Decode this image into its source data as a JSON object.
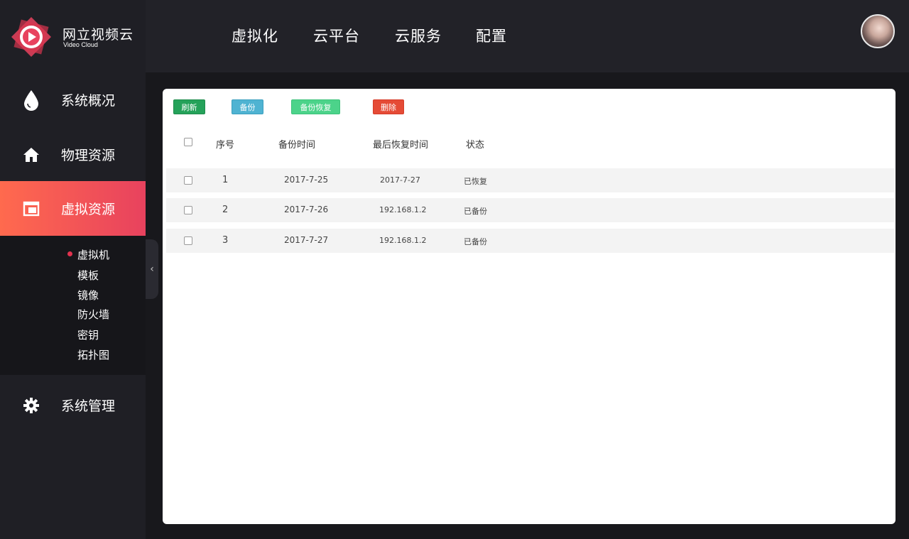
{
  "brand": {
    "name": "网立视频云",
    "subtitle": "Video Cloud",
    "accent": "#e8425e"
  },
  "sidebar": {
    "items": [
      {
        "label": "系统概况",
        "icon": "drop-icon"
      },
      {
        "label": "物理资源",
        "icon": "home-icon"
      },
      {
        "label": "虚拟资源",
        "icon": "window-icon",
        "active": true
      },
      {
        "label": "系统管理",
        "icon": "gear-icon"
      }
    ],
    "submenu": [
      "虚拟机",
      "模板",
      "镜像",
      "防火墙",
      "密钥",
      "拓扑图"
    ],
    "submenu_selected": "虚拟机"
  },
  "topnav": {
    "tabs": [
      "虚拟化",
      "云平台",
      "云服务",
      "配置"
    ]
  },
  "toolbar": {
    "refresh": "刷新",
    "backup": "备份",
    "restore": "备份恢复",
    "delete": "删除"
  },
  "table": {
    "headers": [
      "序号",
      "备份时间",
      "最后恢复时间",
      "状态"
    ],
    "rows": [
      {
        "index": "1",
        "backup_time": "2017-7-25",
        "last_restore": "2017-7-27",
        "status": "已恢复"
      },
      {
        "index": "2",
        "backup_time": "2017-7-26",
        "last_restore": "192.168.1.2",
        "status": "已备份"
      },
      {
        "index": "3",
        "backup_time": "2017-7-27",
        "last_restore": "192.168.1.2",
        "status": "已备份"
      }
    ]
  },
  "colors": {
    "refresh": "#25a25a",
    "backup": "#4fb3d2",
    "restore": "#4cd38a",
    "delete": "#e54b36",
    "active_gradient_start": "#ff6a4e",
    "active_gradient_end": "#e8425e"
  }
}
